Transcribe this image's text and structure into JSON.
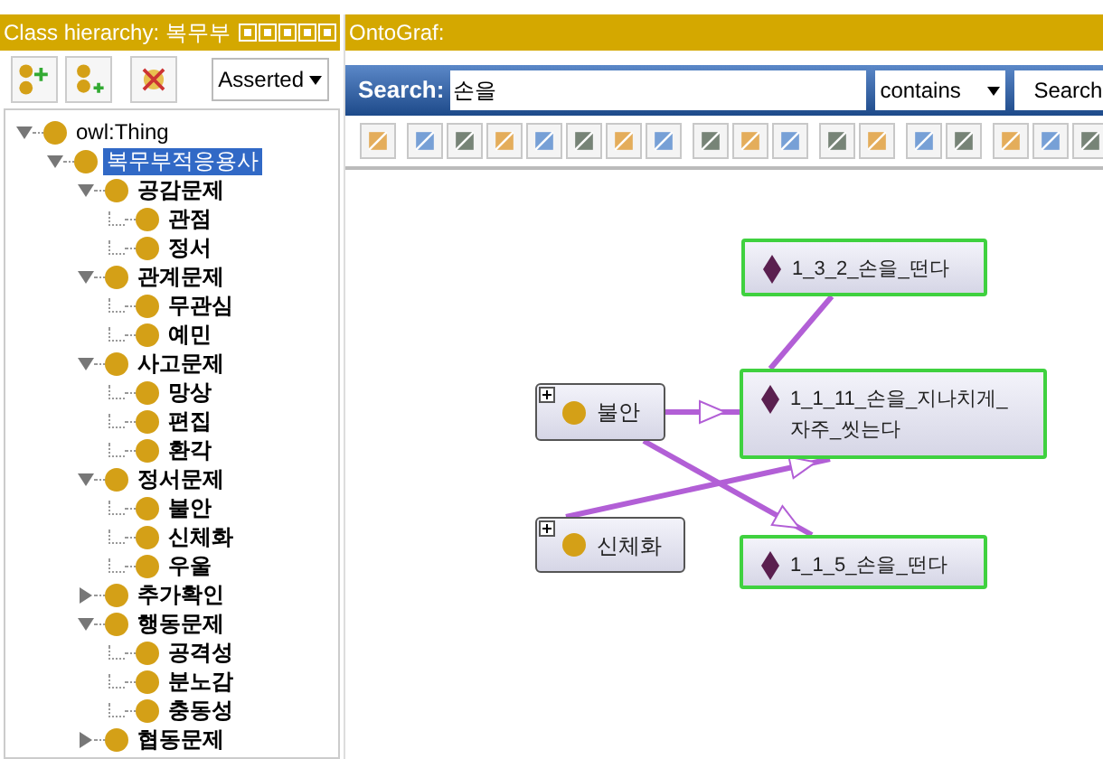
{
  "class_panel": {
    "title": "Class hierarchy: 복무부",
    "view_select": "Asserted",
    "tree": [
      {
        "label": "owl:Thing",
        "expanded": true,
        "selected": false,
        "children": [
          {
            "label": "복무부적응용사",
            "expanded": true,
            "selected": true,
            "children": [
              {
                "label": "공감문제",
                "expanded": true,
                "selected": false,
                "children": [
                  {
                    "label": "관점",
                    "selected": false
                  },
                  {
                    "label": "정서",
                    "selected": false
                  }
                ]
              },
              {
                "label": "관계문제",
                "expanded": true,
                "selected": false,
                "children": [
                  {
                    "label": "무관심",
                    "selected": false
                  },
                  {
                    "label": "예민",
                    "selected": false
                  }
                ]
              },
              {
                "label": "사고문제",
                "expanded": true,
                "selected": false,
                "children": [
                  {
                    "label": "망상",
                    "selected": false
                  },
                  {
                    "label": "편집",
                    "selected": false
                  },
                  {
                    "label": "환각",
                    "selected": false
                  }
                ]
              },
              {
                "label": "정서문제",
                "expanded": true,
                "selected": false,
                "children": [
                  {
                    "label": "불안",
                    "selected": false
                  },
                  {
                    "label": "신체화",
                    "selected": false
                  },
                  {
                    "label": "우울",
                    "selected": false
                  }
                ]
              },
              {
                "label": "추가확인",
                "expanded": false,
                "selected": false
              },
              {
                "label": "행동문제",
                "expanded": true,
                "selected": false,
                "children": [
                  {
                    "label": "공격성",
                    "selected": false
                  },
                  {
                    "label": "분노감",
                    "selected": false
                  },
                  {
                    "label": "충동성",
                    "selected": false
                  }
                ]
              },
              {
                "label": "협동문제",
                "expanded": false,
                "selected": false
              }
            ]
          }
        ]
      }
    ]
  },
  "ontograf": {
    "title": "OntoGraf:",
    "search_label": "Search:",
    "search_value": "손을",
    "match_select": "contains",
    "search_button": "Search",
    "nodes": [
      {
        "kind": "individual",
        "label": "1_3_2_손을_떤다"
      },
      {
        "kind": "class",
        "label": "불안"
      },
      {
        "kind": "individual",
        "label": "1_1_11_손을_지나치게_자주_씻는다"
      },
      {
        "kind": "class",
        "label": "신체화"
      },
      {
        "kind": "individual",
        "label": "1_1_5_손을_떤다"
      }
    ]
  }
}
